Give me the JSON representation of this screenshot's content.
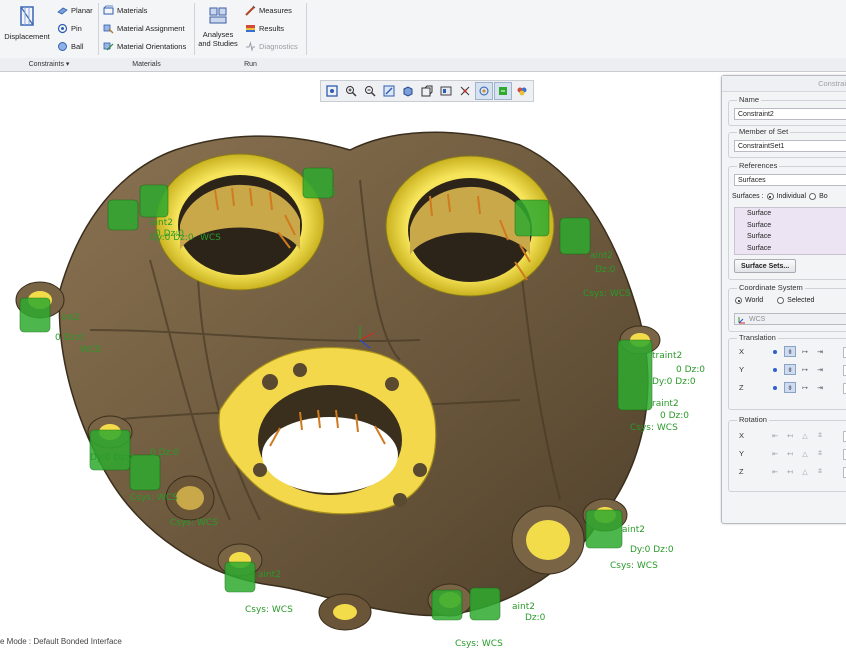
{
  "ribbon": {
    "constraints": {
      "displacement": "Displacement",
      "planar": "Planar",
      "pin": "Pin",
      "ball": "Ball",
      "group_label": "Constraints ▾"
    },
    "materials": {
      "materials": "Materials",
      "assignment": "Material Assignment",
      "orientations": "Material Orientations",
      "group_label": "Materials"
    },
    "run": {
      "analyses_line1": "Analyses",
      "analyses_line2": "and Studies",
      "measures": "Measures",
      "results": "Results",
      "diagnostics": "Diagnostics",
      "group_label": "Run"
    }
  },
  "view_toolbar": {
    "icons": [
      "refit-icon",
      "zoom-in-icon",
      "zoom-out-icon",
      "repaint-icon",
      "display-style-icon",
      "saved-orientations-icon",
      "view-manager-icon",
      "datum-display-icon",
      "spin-center-icon",
      "annotation-display-icon",
      "appearance-icon"
    ]
  },
  "viewport": {
    "status_text": "e Mode : Default Bonded Interface",
    "labels": [
      "aint2",
      "0 Dz:0",
      "aint2",
      "Dz:0",
      "Csys: WCS",
      "Dy:0 Dz:0",
      "WCS",
      "S",
      "int2",
      "0 Dz:0",
      "WCS",
      "traint2",
      "0 Dz:0",
      "Dy:0 Dz:0",
      "Csys: WCS",
      "0 Dz:0",
      "Csys: WCS",
      "aint2",
      "Csys: WCS",
      "aint2",
      "Dz:0",
      "Csys: WCS",
      "aint2",
      "Dy:0 Dz:0",
      "Csys: WCS",
      "raint2",
      "0 Dz:0",
      "Dy:0 Dz:0",
      "Csys: WCS"
    ]
  },
  "panel": {
    "title": "Constrai",
    "name_label": "Name",
    "name_value": "Constraint2",
    "member_label": "Member of Set",
    "member_value": "ConstraintSet1",
    "references_label": "References",
    "references_value": "Surfaces",
    "surfaces_label": "Surfaces :",
    "individual_label": "Individual",
    "boundary_label": "Bo",
    "surfaces": [
      "Surface",
      "Surface",
      "Surface",
      "Surface"
    ],
    "surface_sets_button": "Surface Sets...",
    "coord_label": "Coordinate System",
    "world_label": "World",
    "selected_label": "Selected",
    "csys_value": "WCS",
    "translation_label": "Translation",
    "rotation_label": "Rotation",
    "axes": [
      "X",
      "Y",
      "Z"
    ]
  }
}
